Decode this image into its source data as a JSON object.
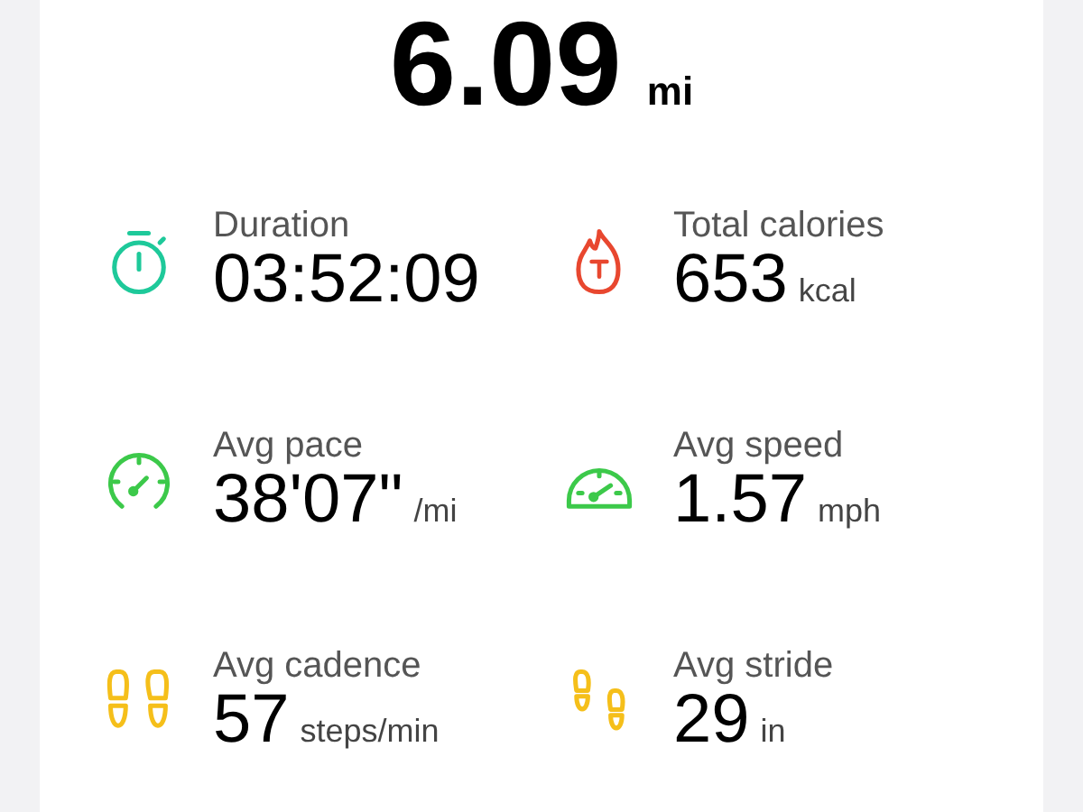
{
  "distance": {
    "value": "6.09",
    "unit": "mi"
  },
  "stats": [
    {
      "label": "Duration",
      "value": "03:52:09",
      "kind": "stopwatch",
      "color": "#1ec99a"
    },
    {
      "label": "Total calories",
      "value": "653",
      "unit": "kcal",
      "kind": "flame",
      "color": "#e8472f"
    },
    {
      "label": "Avg pace",
      "value": "38'07\"",
      "unit": "/mi",
      "kind": "pace-gauge",
      "color": "#3cc94a"
    },
    {
      "label": "Avg speed",
      "value": "1.57",
      "unit": "mph",
      "kind": "speed-gauge",
      "color": "#3cc94a"
    },
    {
      "label": "Avg cadence",
      "value": "57",
      "unit": "steps/min",
      "kind": "footprints",
      "color": "#f5bf1a"
    },
    {
      "label": "Avg stride",
      "value": "29",
      "unit": "in",
      "kind": "stride",
      "color": "#f5bf1a"
    }
  ]
}
